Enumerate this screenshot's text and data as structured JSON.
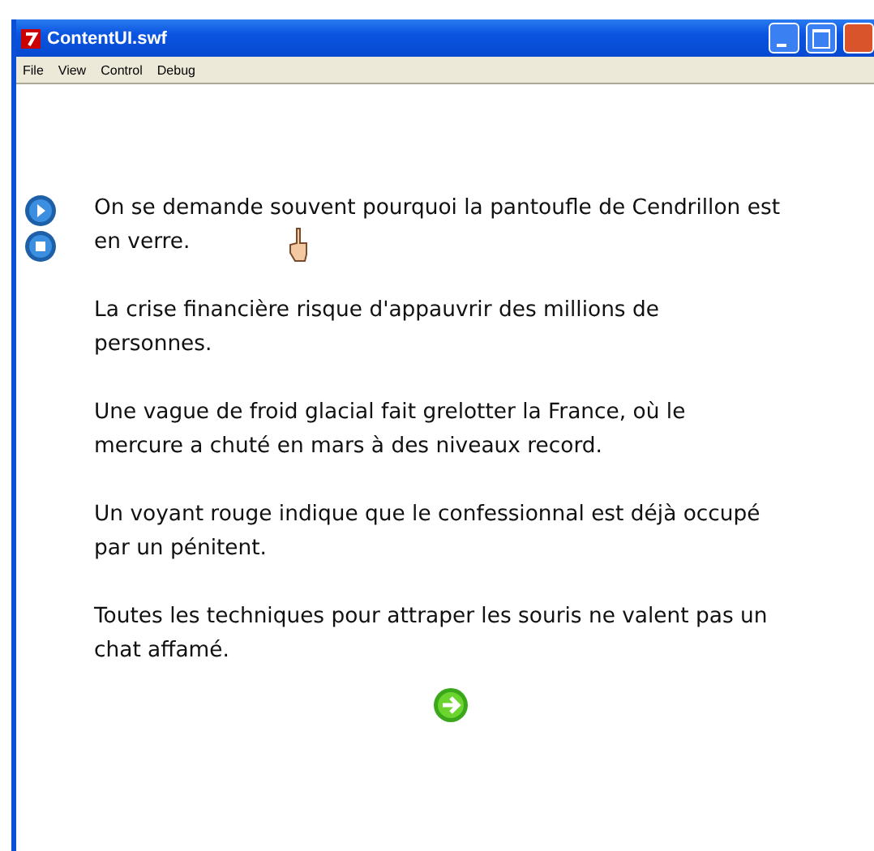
{
  "window": {
    "title": "ContentUI.swf"
  },
  "menu": [
    "File",
    "View",
    "Control",
    "Debug"
  ],
  "paragraphs": [
    [
      "On se demande souvent pourquoi la pantoufle de Cendrillon est",
      "en verre."
    ],
    [
      "La crise financière risque d'appauvrir des millions de",
      "personnes."
    ],
    [
      "Une vague de froid glacial fait grelotter la France, où le",
      "mercure a chuté en mars à des niveaux record."
    ],
    [
      "Un voyant rouge indique que le confessionnal est déjà occupé",
      "par un pénitent."
    ],
    [
      "Toutes les techniques pour attraper les souris ne valent pas un",
      "chat affamé."
    ]
  ]
}
